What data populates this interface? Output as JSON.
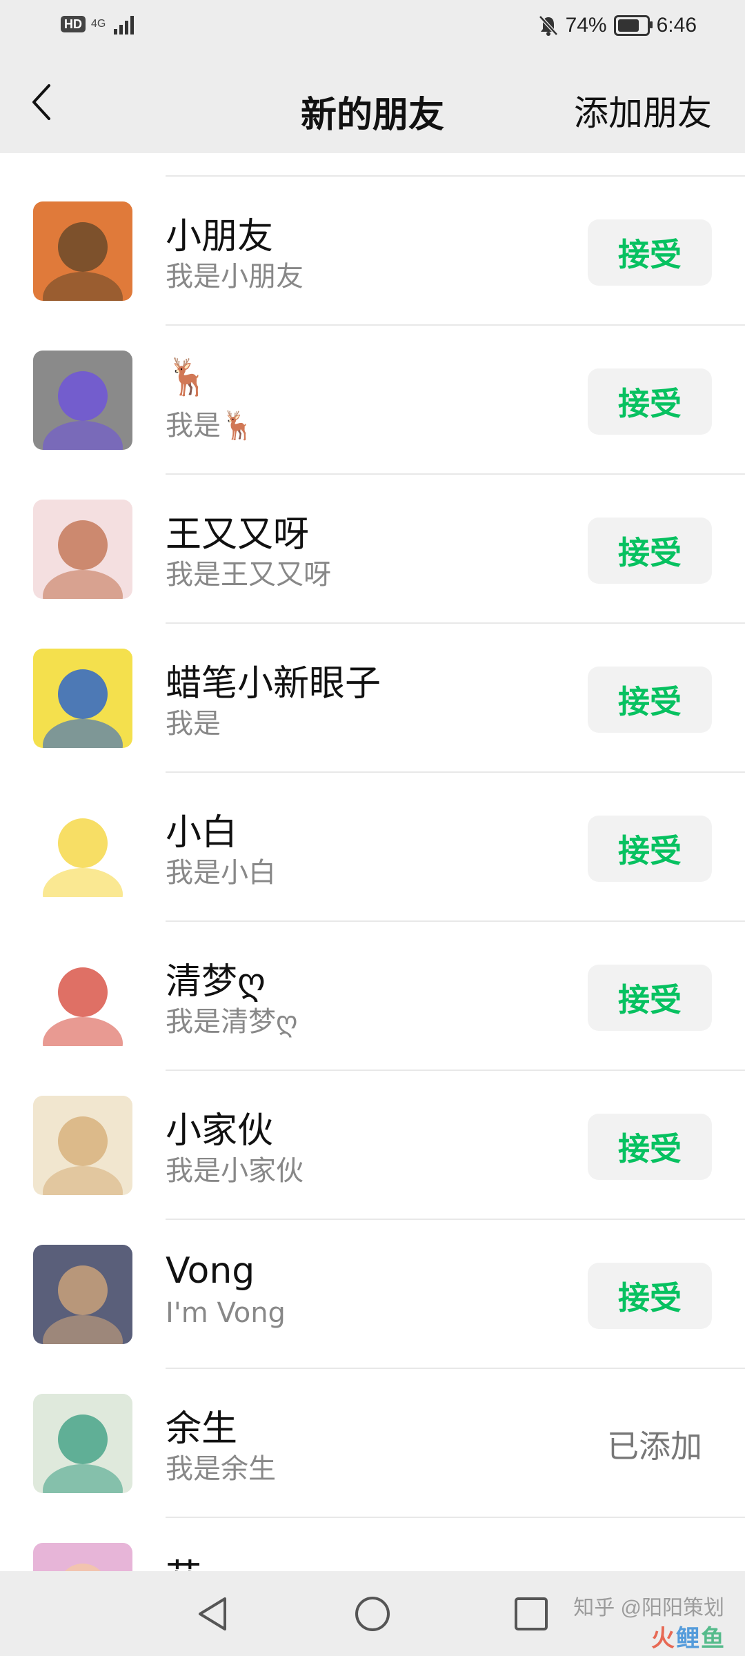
{
  "status_bar": {
    "hd_badge": "HD",
    "network": "4G",
    "battery_percent": "74%",
    "battery_level": 0.74,
    "time": "6:46"
  },
  "header": {
    "title": "新的朋友",
    "action": "添加朋友"
  },
  "accept_color": "#07c160",
  "rows": [
    {
      "name": "小朋友",
      "message": "我是小朋友",
      "action": "接受",
      "status": "pending",
      "avatar_colors": [
        "#e07a3a",
        "#6b4a2a"
      ]
    },
    {
      "name": "🦌",
      "message": "我是🦌",
      "action": "接受",
      "status": "pending",
      "avatar_colors": [
        "#8a8a8a",
        "#6e55d8"
      ]
    },
    {
      "name": "王又又呀",
      "message": "我是王又又呀",
      "action": "接受",
      "status": "pending",
      "avatar_colors": [
        "#f4dfe0",
        "#c47a5a"
      ]
    },
    {
      "name": "蜡笔小新眼子",
      "message": "我是",
      "action": "接受",
      "status": "pending",
      "avatar_colors": [
        "#f4e04d",
        "#2f66c8"
      ]
    },
    {
      "name": "小白",
      "message": "我是小白",
      "action": "接受",
      "status": "pending",
      "avatar_colors": [
        "#ffffff",
        "#f6d84a"
      ]
    },
    {
      "name": "清梦ღ",
      "message": "我是清梦ღ",
      "action": "接受",
      "status": "pending",
      "avatar_colors": [
        "#ffffff",
        "#d9574a"
      ]
    },
    {
      "name": "小家伙",
      "message": "我是小家伙",
      "action": "接受",
      "status": "pending",
      "avatar_colors": [
        "#f1e6cf",
        "#d8b27e"
      ]
    },
    {
      "name": "Vong",
      "message": "I'm Vong",
      "action": "接受",
      "status": "pending",
      "avatar_colors": [
        "#5a5f7a",
        "#c9a17a"
      ]
    },
    {
      "name": "余生",
      "message": "我是余生",
      "action": "已添加",
      "status": "added",
      "avatar_colors": [
        "#dfe9dc",
        "#4aa58a"
      ]
    },
    {
      "name": "苁",
      "message": "",
      "action": "",
      "status": "partial",
      "avatar_colors": [
        "#e7b5d8",
        "#f3c7a8"
      ]
    }
  ],
  "nav": {
    "icons": [
      "back-triangle-icon",
      "home-circle-icon",
      "recents-square-icon"
    ]
  },
  "watermark": {
    "text": "知乎 @阳阳策划",
    "logo": [
      "火",
      "鲤",
      "鱼"
    ]
  }
}
